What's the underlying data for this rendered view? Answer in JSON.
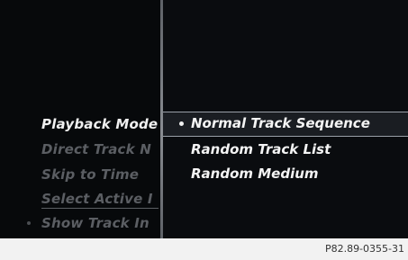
{
  "menu": {
    "items": [
      {
        "label": "Playback Mode",
        "state": "active"
      },
      {
        "label": "Direct Track N",
        "state": "disabled"
      },
      {
        "label": "Skip to Time",
        "state": "disabled"
      },
      {
        "label": "Select Active I",
        "state": "disabled"
      },
      {
        "label": "Show Track In",
        "state": "disabled"
      }
    ]
  },
  "submenu": {
    "options": [
      {
        "label": "Normal Track Sequence",
        "selected": true
      },
      {
        "label": "Random Track List",
        "selected": false
      },
      {
        "label": "Random Medium",
        "selected": false
      }
    ]
  },
  "caption": "P82.89-0355-31",
  "colors": {
    "background": "#060708",
    "text_active": "#f0f0f0",
    "text_disabled": "#5b5e63",
    "highlight_row": "#1a1d22"
  }
}
